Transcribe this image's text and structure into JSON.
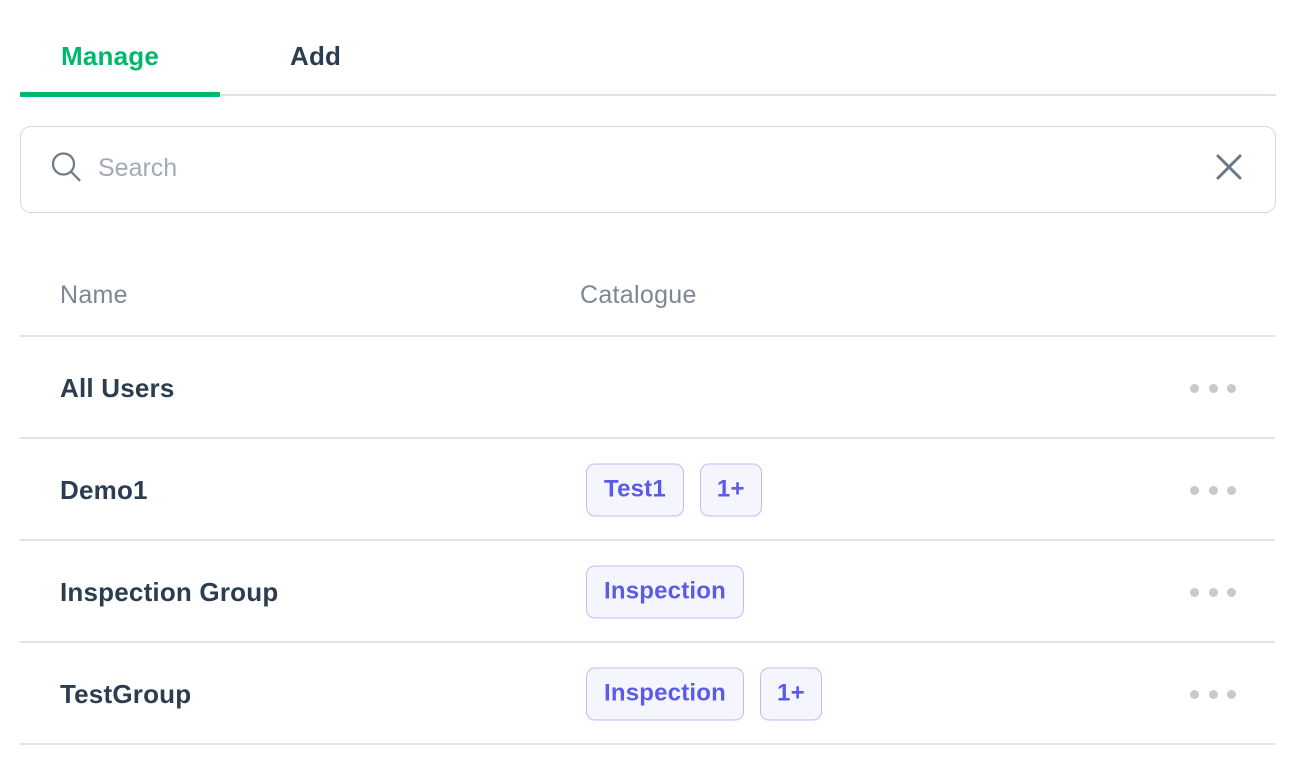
{
  "tabs": [
    {
      "label": "Manage",
      "active": true
    },
    {
      "label": "Add",
      "active": false
    }
  ],
  "search": {
    "placeholder": "Search",
    "value": "",
    "icon": "search-icon",
    "clear_icon": "close-icon"
  },
  "table": {
    "columns": [
      "Name",
      "Catalogue"
    ],
    "rows": [
      {
        "name": "All Users",
        "catalogue": []
      },
      {
        "name": "Demo1",
        "catalogue": [
          "Test1",
          "1+"
        ]
      },
      {
        "name": "Inspection Group",
        "catalogue": [
          "Inspection"
        ]
      },
      {
        "name": "TestGroup",
        "catalogue": [
          "Inspection",
          "1+"
        ]
      }
    ],
    "row_menu_icon": "more-horizontal-icon"
  },
  "colors": {
    "accent_green": "#00B86B",
    "tab_inactive": "#2B3D51",
    "header_gray": "#7C8795",
    "row_text": "#2B3D4F",
    "chip_text": "#5B5BE8",
    "chip_border": "#BDBDF5",
    "chip_bg": "#F5F5FD",
    "divider": "#E1E3E7"
  }
}
